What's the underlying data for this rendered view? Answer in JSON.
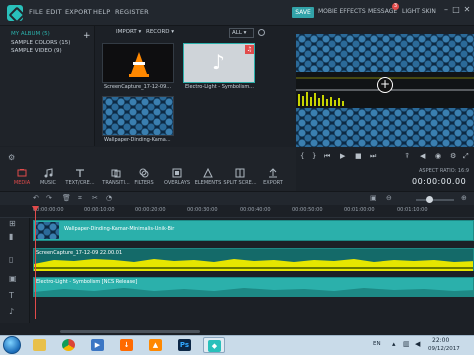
{
  "menubar": {
    "items": [
      "FILE",
      "EDIT",
      "EXPORT",
      "HELP",
      "REGISTER"
    ],
    "save_label": "SAVE",
    "mobile_effects": "MOBIE EFFECTS",
    "message": "MESSAGE",
    "message_count": "3",
    "light_skin": "LIGHT SKIN"
  },
  "album": {
    "title": "MY ALBUM (5)",
    "items": [
      "SAMPLE COLORS (15)",
      "SAMPLE VIDEO (9)"
    ],
    "add": "+"
  },
  "media": {
    "import_label": "IMPORT",
    "record_label": "RECORD",
    "view_value": "ALL",
    "items": [
      {
        "caption": "ScreenCapture_17-12-09..."
      },
      {
        "caption": "Electro-Light - Symbolism..."
      },
      {
        "caption": "Wallpaper-Dinding-Kama..."
      }
    ]
  },
  "tools": [
    {
      "label": "MEDIA"
    },
    {
      "label": "MUSIC"
    },
    {
      "label": "TEXT/CRE..."
    },
    {
      "label": "TRANSITI..."
    },
    {
      "label": "FILTERS"
    },
    {
      "label": "OVERLAYS"
    },
    {
      "label": "ELEMENTS"
    },
    {
      "label": "SPLIT SCRE..."
    },
    {
      "label": "EXPORT"
    }
  ],
  "preview": {
    "aspect_label": "ASPECT RATIO: 16:9",
    "timecode": "00:00:00.00"
  },
  "timeline": {
    "ticks": [
      "00:00:00:00",
      "00:00:10:00",
      "00:00:20:00",
      "00:00:30:00",
      "00:00:40:00",
      "00:00:50:00",
      "00:01:00:00",
      "00:01:10:00"
    ],
    "clips": {
      "video": "Wallpaper-Dinding-Kamar-Minimalis-Unik-Bir",
      "screen": "ScreenCapture_17-12-09 22.00.01",
      "audio": "Electro-Light - Symbolism [NCS Release]"
    }
  },
  "taskbar": {
    "lang": "EN",
    "time": "22:00",
    "date": "09/12/2017"
  },
  "colors": {
    "accent": "#2bb0ab",
    "active_tab": "#e14b4b",
    "waveform": "#e6e600"
  }
}
